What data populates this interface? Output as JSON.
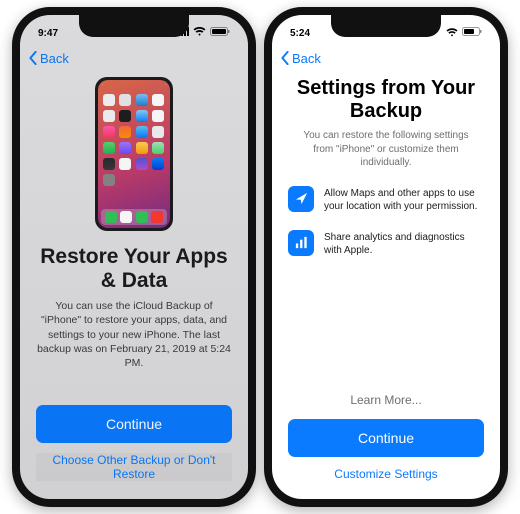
{
  "phone1": {
    "status_time": "9:47",
    "back_label": "Back",
    "title": "Restore Your Apps & Data",
    "description": "You can use the iCloud Backup of \"iPhone\" to restore your apps, data, and settings to your new iPhone. The last backup was on February 21, 2019 at 5:24 PM.",
    "continue_label": "Continue",
    "secondary_label": "Choose Other Backup or Don't Restore"
  },
  "phone2": {
    "status_time": "5:24",
    "back_label": "Back",
    "title": "Settings from Your Backup",
    "description": "You can restore the following settings from \"iPhone\" or customize them individually.",
    "items": [
      {
        "icon": "location-arrow-icon",
        "text": "Allow Maps and other apps to use your location with your permission."
      },
      {
        "icon": "analytics-bars-icon",
        "text": "Share analytics and diagnostics with Apple."
      }
    ],
    "learn_label": "Learn More...",
    "continue_label": "Continue",
    "secondary_label": "Customize Settings"
  },
  "colors": {
    "accent": "#0a7aff"
  }
}
